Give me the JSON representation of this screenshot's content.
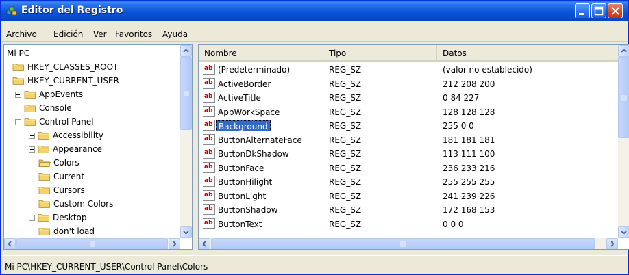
{
  "window": {
    "title": "Editor del Registro"
  },
  "menu": [
    "Archivo",
    "Edición",
    "Ver",
    "Favoritos",
    "Ayuda"
  ],
  "tree": {
    "items": [
      {
        "label": "Mi PC",
        "level": 0,
        "expander": "none",
        "folder": false
      },
      {
        "label": "HKEY_CLASSES_ROOT",
        "level": 1,
        "expander": "none",
        "folder": true
      },
      {
        "label": "HKEY_CURRENT_USER",
        "level": 1,
        "expander": "none",
        "folder": true
      },
      {
        "label": "AppEvents",
        "level": 2,
        "expander": "plus",
        "folder": true
      },
      {
        "label": "Console",
        "level": 2,
        "expander": "none",
        "folder": true
      },
      {
        "label": "Control Panel",
        "level": 2,
        "expander": "minus",
        "folder": true
      },
      {
        "label": "Accessibility",
        "level": 3,
        "expander": "plus",
        "folder": true
      },
      {
        "label": "Appearance",
        "level": 3,
        "expander": "plus",
        "folder": true
      },
      {
        "label": "Colors",
        "level": 3,
        "expander": "none",
        "folder": true
      },
      {
        "label": "Current",
        "level": 3,
        "expander": "none",
        "folder": true
      },
      {
        "label": "Cursors",
        "level": 3,
        "expander": "none",
        "folder": true
      },
      {
        "label": "Custom Colors",
        "level": 3,
        "expander": "none",
        "folder": true
      },
      {
        "label": "Desktop",
        "level": 3,
        "expander": "plus",
        "folder": true
      },
      {
        "label": "don't load",
        "level": 3,
        "expander": "none",
        "folder": true
      }
    ]
  },
  "list": {
    "columns": [
      "Nombre",
      "Tipo",
      "Datos"
    ],
    "selected_row": "Background",
    "rows": [
      {
        "name": "(Predeterminado)",
        "type": "REG_SZ",
        "data": "(valor no establecido)"
      },
      {
        "name": "ActiveBorder",
        "type": "REG_SZ",
        "data": "212 208 200"
      },
      {
        "name": "ActiveTitle",
        "type": "REG_SZ",
        "data": "0 84 227"
      },
      {
        "name": "AppWorkSpace",
        "type": "REG_SZ",
        "data": "128 128 128"
      },
      {
        "name": "Background",
        "type": "REG_SZ",
        "data": "255 0 0"
      },
      {
        "name": "ButtonAlternateFace",
        "type": "REG_SZ",
        "data": "181 181 181"
      },
      {
        "name": "ButtonDkShadow",
        "type": "REG_SZ",
        "data": "113 111 100"
      },
      {
        "name": "ButtonFace",
        "type": "REG_SZ",
        "data": "236 233 216"
      },
      {
        "name": "ButtonHilight",
        "type": "REG_SZ",
        "data": "255 255 255"
      },
      {
        "name": "ButtonLight",
        "type": "REG_SZ",
        "data": "241 239 226"
      },
      {
        "name": "ButtonShadow",
        "type": "REG_SZ",
        "data": "172 168 153"
      },
      {
        "name": "ButtonText",
        "type": "REG_SZ",
        "data": "0 0 0"
      }
    ],
    "value_icon": "ab"
  },
  "status": {
    "path": "Mi PC\\HKEY_CURRENT_USER\\Control Panel\\Colors"
  },
  "colors": {
    "titlebar": "#0a55d8",
    "selection": "#316ac5",
    "folder": "#f5d36c"
  }
}
